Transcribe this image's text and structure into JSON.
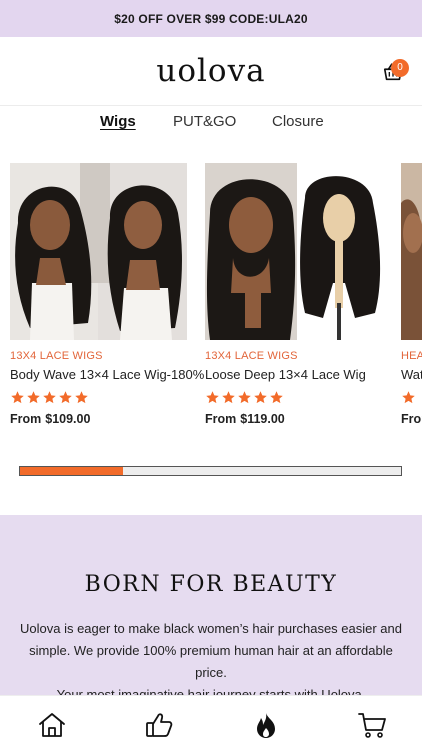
{
  "promo": {
    "text": "$20 OFF OVER $99 CODE:ULA20"
  },
  "header": {
    "logo": "uolova",
    "cart_count": "0"
  },
  "tabs": [
    {
      "label": "Wigs",
      "active": true
    },
    {
      "label": "PUT&GO",
      "active": false
    },
    {
      "label": "Closure",
      "active": false
    }
  ],
  "products": [
    {
      "category": "13X4 LACE WIGS",
      "title": "Body Wave 13×4 Lace Wig-180%",
      "price_prefix": "From",
      "price": "$109.00",
      "rating": 5
    },
    {
      "category": "13X4 LACE WIGS",
      "title": "Loose Deep 13×4 Lace Wig",
      "price_prefix": "From",
      "price": "$119.00",
      "rating": 5
    },
    {
      "category": "HEA",
      "title": "Wat",
      "price_prefix": "Fror",
      "price": "",
      "rating": 5
    }
  ],
  "carousel_progress": 0.27,
  "about": {
    "title": "BORN FOR BEAUTY",
    "line1": "Uolova is eager to make black women’s hair purchases easier and",
    "line2": "simple. We provide 100% premium human hair at an affordable price.",
    "line3": "Your most imaginative hair journey starts with Uolova."
  },
  "bottom_nav": [
    "home-icon",
    "thumbs-up-icon",
    "fire-icon",
    "cart-icon"
  ],
  "colors": {
    "accent": "#f26b2a",
    "promo_bg": "#e3d6ef",
    "about_bg": "#e6dcf0",
    "category_text": "#e2653a"
  }
}
